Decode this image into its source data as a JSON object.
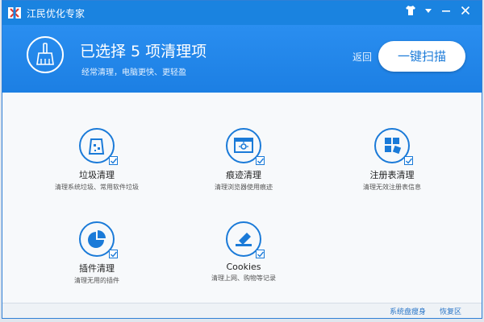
{
  "titlebar": {
    "title": "江民优化专家"
  },
  "header": {
    "title": "已选择 5 项清理项",
    "subtitle": "经常清理，电脑更快、更轻盈",
    "back_label": "返回",
    "scan_label": "一键扫描"
  },
  "items": [
    {
      "label": "垃圾清理",
      "desc": "清理系统垃圾、常用软件垃圾",
      "icon": "trash-bin-icon",
      "checked": true
    },
    {
      "label": "痕迹清理",
      "desc": "清理浏览器使用痕迹",
      "icon": "browser-traces-icon",
      "checked": true
    },
    {
      "label": "注册表清理",
      "desc": "清理无效注册表信息",
      "icon": "registry-icon",
      "checked": true
    },
    {
      "label": "插件清理",
      "desc": "清理无用的插件",
      "icon": "plugin-icon",
      "checked": true
    },
    {
      "label": "Cookies",
      "desc": "清理上网、购物等记录",
      "icon": "cookies-icon",
      "checked": true
    }
  ],
  "footer": {
    "link1": "系统盘瘦身",
    "link2": "恢复区"
  },
  "colors": {
    "accent": "#1a83e0",
    "button_text": "#1a7ad8"
  }
}
